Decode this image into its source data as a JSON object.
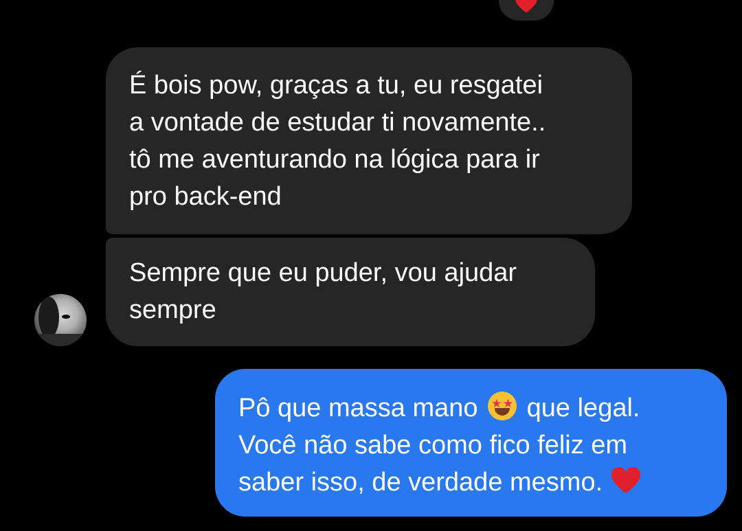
{
  "conversation": {
    "top_reaction": {
      "icon": "heart-icon",
      "color": "#e0202b"
    },
    "messages": [
      {
        "direction": "incoming",
        "lines": [
          "É bois pow, graças a tu, eu resgatei",
          "a vontade de estudar ti novamente..",
          "tô me aventurando na lógica para ir",
          "pro back-end"
        ]
      },
      {
        "direction": "incoming",
        "lines": [
          "Sempre que eu puder, vou ajudar",
          "sempre"
        ],
        "avatar": "contact-avatar"
      },
      {
        "direction": "outgoing",
        "line1_before_emoji": "Pô que massa mano",
        "line1_emoji": "star-struck-emoji",
        "line1_after_emoji": "que legal.",
        "line2": "Você não sabe como fico feliz em",
        "line3": "saber isso, de verdade mesmo.",
        "line3_emoji": "heart-icon"
      }
    ]
  },
  "colors": {
    "background": "#000000",
    "incoming_bubble": "#262626",
    "outgoing_bubble": "#2a78ee",
    "text": "#ffffff",
    "heart": "#e0202b"
  }
}
